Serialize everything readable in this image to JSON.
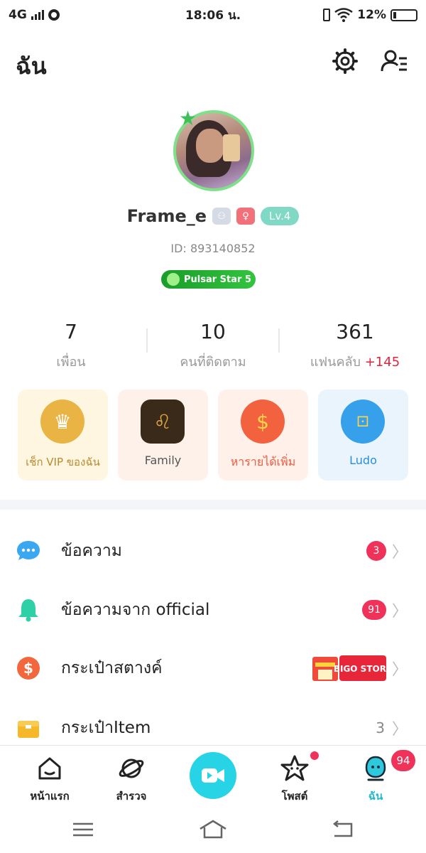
{
  "status_bar": {
    "network": "4G",
    "time": "18:06 น.",
    "battery": "12%"
  },
  "header": {
    "title": "ฉัน",
    "settings_icon": "gear-icon",
    "profile_menu_icon": "user-list-icon"
  },
  "profile": {
    "username": "Frame_e",
    "level": "Lv.4",
    "id_text": "ID: 893140852",
    "pulsar_badge": "Pulsar Star 5"
  },
  "stats": [
    {
      "value": "7",
      "label": "เพื่อน"
    },
    {
      "value": "10",
      "label": "คนที่ติดตาม"
    },
    {
      "value": "361",
      "label": "แฟนคลับ",
      "extra": "+145"
    }
  ],
  "cards": [
    {
      "label": "เช็ก VIP ของฉัน",
      "icon": "crown-icon",
      "label_color": "#b88a2c",
      "bg": "#fff6e2",
      "icon_bg": "#eab444"
    },
    {
      "label": "Family",
      "icon": "lion-icon",
      "label_color": "#555555",
      "bg": "#fdf1ea",
      "icon_bg": "#3a2a1a"
    },
    {
      "label": "หารายได้เพิ่ม",
      "icon": "money-bag-icon",
      "label_color": "#f05a3c",
      "bg": "#fff0ea",
      "icon_bg": "#f3623f"
    },
    {
      "label": "Ludo",
      "icon": "ludo-icon",
      "label_color": "#2a8fd6",
      "bg": "#eaf4fd",
      "icon_bg": "#36a0ea"
    }
  ],
  "menu": [
    {
      "label": "ข้อความ",
      "icon": "chat-bubble-icon",
      "badge": "3"
    },
    {
      "label": "ข้อความจาก official",
      "icon": "bell-icon",
      "badge": "91"
    },
    {
      "label": "กระเป๋าสตางค์",
      "icon": "dollar-coin-icon",
      "promo": "BIGO STORE"
    },
    {
      "label": "กระเป๋าItem",
      "icon": "item-box-icon",
      "count": "3"
    }
  ],
  "bottom_nav": {
    "items": [
      {
        "label": "หน้าแรก",
        "icon": "home-icon"
      },
      {
        "label": "สำรวจ",
        "icon": "planet-icon"
      },
      {
        "label": "โพสต์",
        "icon": "star-face-icon"
      },
      {
        "label": "ฉัน",
        "icon": "me-icon"
      }
    ],
    "me_badge": "94",
    "live_icon": "video-camera-icon"
  },
  "colors": {
    "accent": "#22b8cf",
    "badge_red": "#f0315a",
    "level_teal": "#7fd9c4",
    "pulsar_green": "#1a9c2a"
  }
}
